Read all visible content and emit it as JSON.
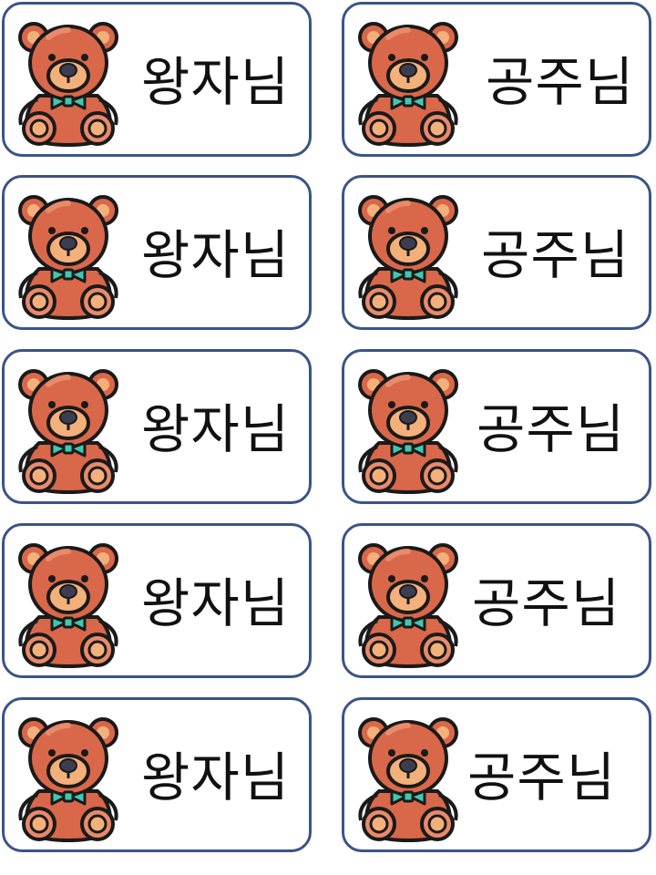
{
  "colors": {
    "card_border": "#3b5488",
    "bear_body": "#d9684a",
    "bear_dark": "#b84b33",
    "bear_light": "#f4b07a",
    "bear_outline": "#1a1a1a",
    "bowtie": "#3ec9b0",
    "nose": "#3d3d52"
  },
  "icon": "teddy-bear-icon",
  "cards": [
    {
      "label": "왕자님"
    },
    {
      "label": "공주님"
    },
    {
      "label": "왕자님"
    },
    {
      "label": "공주님"
    },
    {
      "label": "왕자님"
    },
    {
      "label": "공주님"
    },
    {
      "label": "왕자님"
    },
    {
      "label": "공주님"
    },
    {
      "label": "왕자님"
    },
    {
      "label": "공주님"
    }
  ]
}
